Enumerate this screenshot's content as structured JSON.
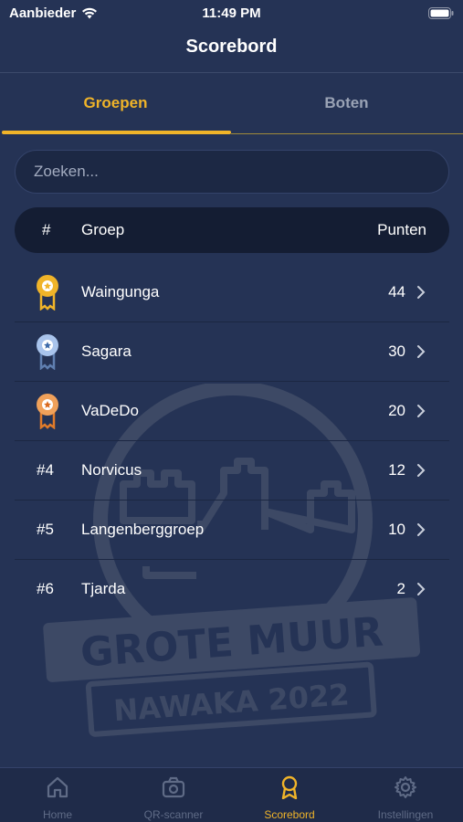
{
  "status_bar": {
    "carrier": "Aanbieder",
    "time": "11:49 PM"
  },
  "nav": {
    "title": "Scorebord"
  },
  "tabs": [
    {
      "label": "Groepen",
      "active": true
    },
    {
      "label": "Boten",
      "active": false
    }
  ],
  "search": {
    "placeholder": "Zoeken..."
  },
  "table_header": {
    "rank": "#",
    "group": "Groep",
    "points": "Punten"
  },
  "rows": [
    {
      "rank": "",
      "medal": "gold-medal-icon",
      "name": "Waingunga",
      "points": "44"
    },
    {
      "rank": "",
      "medal": "silver-medal-icon",
      "name": "Sagara",
      "points": "30"
    },
    {
      "rank": "",
      "medal": "bronze-medal-icon",
      "name": "VaDeDo",
      "points": "20"
    },
    {
      "rank": "#4",
      "name": "Norvicus",
      "points": "12"
    },
    {
      "rank": "#5",
      "name": "Langenberggroep",
      "points": "10"
    },
    {
      "rank": "#6",
      "name": "Tjarda",
      "points": "2"
    }
  ],
  "watermark": {
    "title": "GROTE MUUR",
    "subtitle": "NAWAKA 2022"
  },
  "tabbar": [
    {
      "label": "Home",
      "icon": "home-icon"
    },
    {
      "label": "QR-scanner",
      "icon": "camera-icon"
    },
    {
      "label": "Scorebord",
      "icon": "award-icon",
      "active": true
    },
    {
      "label": "Instellingen",
      "icon": "gear-icon"
    }
  ],
  "colors": {
    "background": "#253355",
    "accent": "#f0b429",
    "header_row": "#141d33",
    "tabbar": "#1f2b49"
  }
}
